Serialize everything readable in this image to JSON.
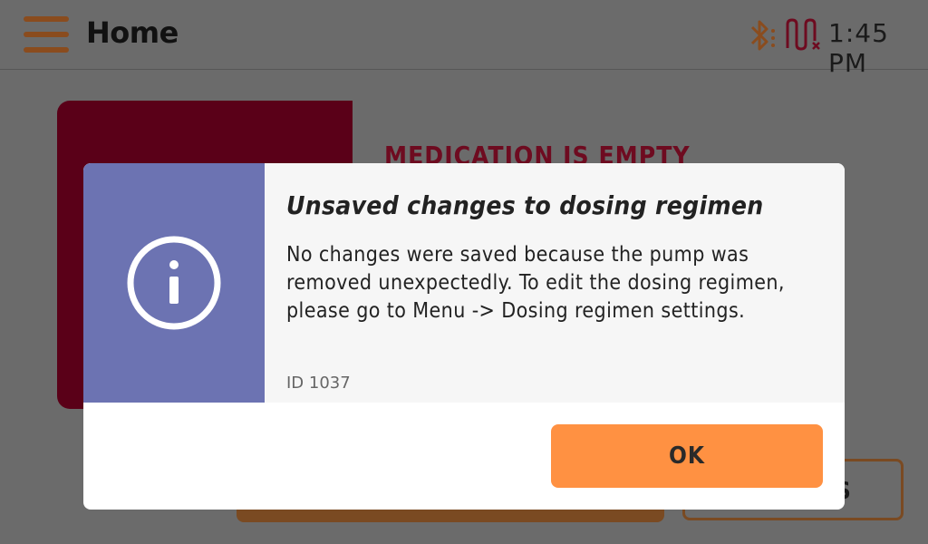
{
  "header": {
    "title": "Home",
    "time": "1:45 PM",
    "menu_icon": "hamburger-menu-icon",
    "status_icons": [
      "bluetooth-icon",
      "pump-disconnected-icon"
    ]
  },
  "background": {
    "alert_text": "MEDICATION IS EMPTY",
    "partial_button_text": "S"
  },
  "dialog": {
    "icon": "info-icon",
    "title": "Unsaved changes to dosing regimen",
    "body_lines": [
      "No changes were saved because the pump was",
      "removed unexpectedly. To edit the dosing regimen,",
      "please go to Menu -> Dosing regimen settings."
    ],
    "id_label": "ID 1037",
    "ok_label": "OK"
  },
  "colors": {
    "accent_orange": "#ff9142",
    "info_panel": "#6c73b2",
    "medication_card": "#5a0018",
    "alert_red": "#c8102e"
  }
}
